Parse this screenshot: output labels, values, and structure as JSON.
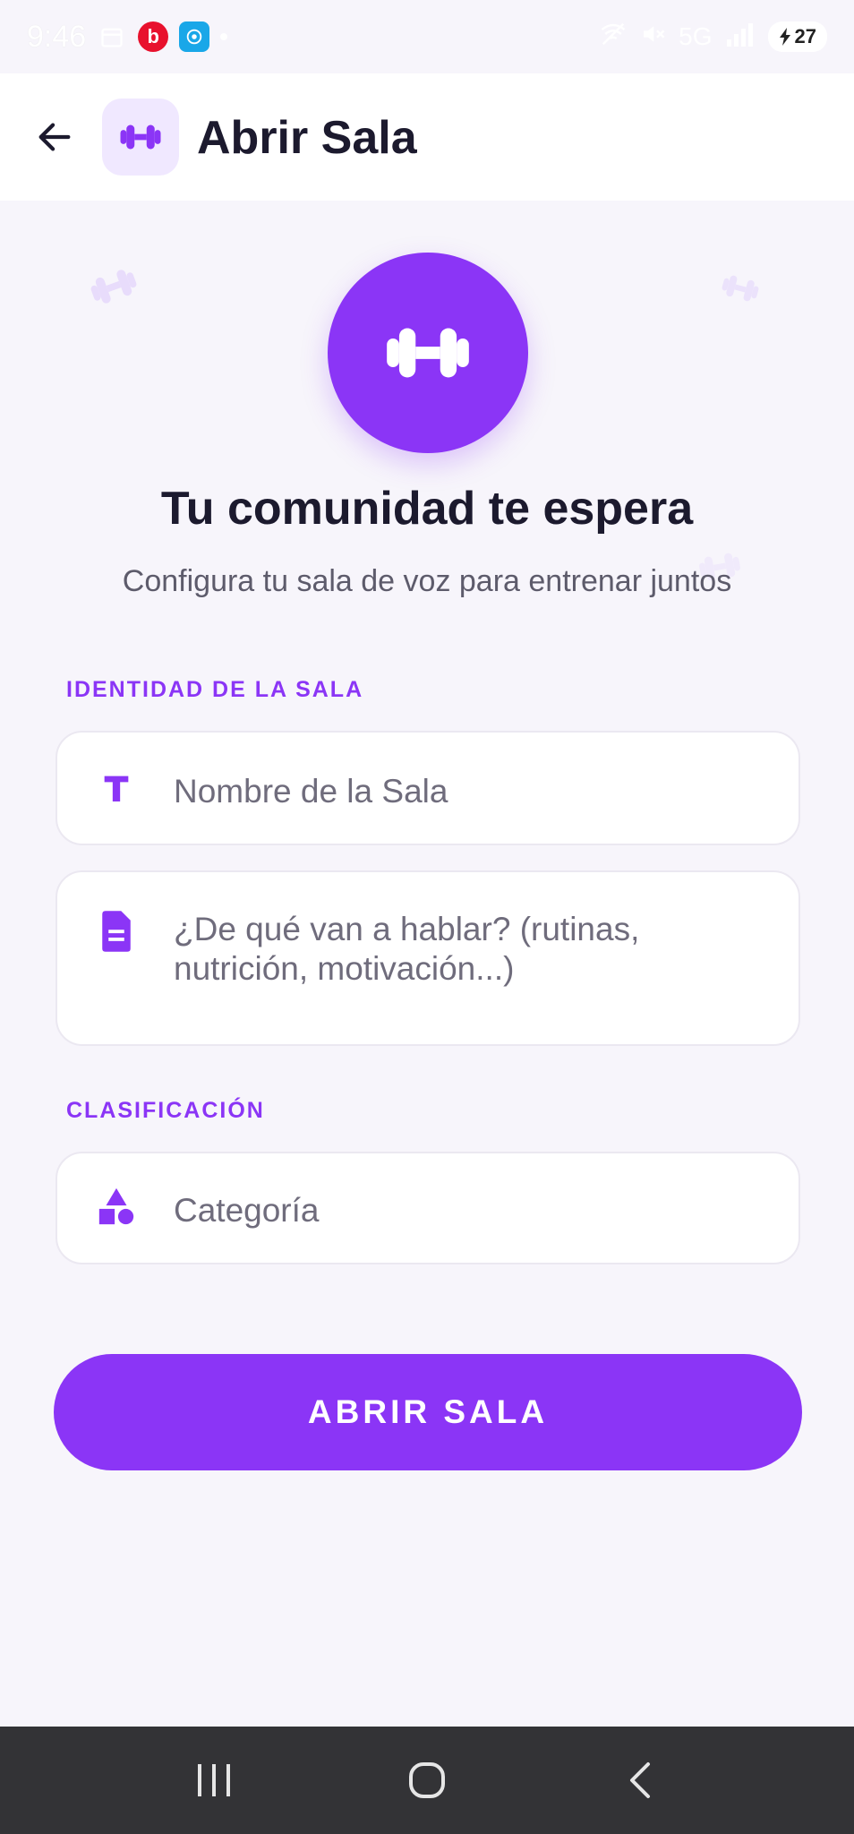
{
  "status_bar": {
    "time": "9:46",
    "network": "5G",
    "battery": "27"
  },
  "app_bar": {
    "title": "Abrir Sala"
  },
  "hero": {
    "title": "Tu comunidad te espera",
    "subtitle": "Configura tu sala de voz para entrenar juntos"
  },
  "sections": {
    "identity_label": "IDENTIDAD DE LA SALA",
    "classification_label": "CLASIFICACIÓN"
  },
  "fields": {
    "room_name_placeholder": "Nombre de la Sala",
    "description_placeholder": "¿De qué van a hablar? (rutinas, nutrición, motivación...)",
    "category_placeholder": "Categoría"
  },
  "actions": {
    "open_room_label": "ABRIR SALA"
  },
  "colors": {
    "accent": "#8b35f6",
    "background": "#f7f5fb",
    "text_dark": "#1c1a2e"
  },
  "icons": {
    "back": "arrow-left-icon",
    "app": "dumbbell-icon",
    "name_field": "text-t-icon",
    "description_field": "document-icon",
    "category_field": "shapes-icon"
  }
}
